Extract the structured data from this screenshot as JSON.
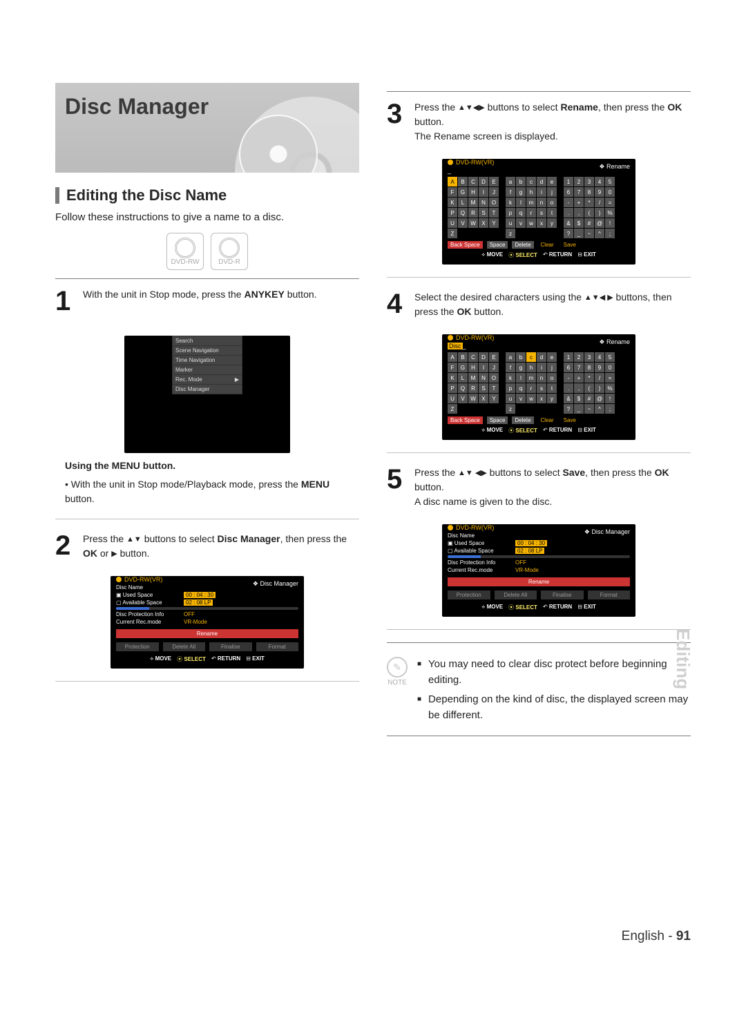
{
  "banner": {
    "title": "Disc Manager"
  },
  "section": {
    "title": "Editing the Disc Name",
    "lead": "Follow these instructions to give a name to a disc."
  },
  "badges": {
    "a": "DVD-RW",
    "b": "DVD-R"
  },
  "step1": {
    "text_pre": "With the unit in Stop mode, press the ",
    "text_bold": "ANYKEY",
    "text_post": " button."
  },
  "step1_sub": {
    "heading": "Using the MENU button.",
    "bullet_pre": "With the unit in Stop mode/Playback mode, press the ",
    "bullet_bold": "MENU",
    "bullet_post": " button."
  },
  "step2": {
    "pre": "Press the ",
    "mid": " buttons to select ",
    "bold1": "Disc Manager",
    "mid2": ", then press the ",
    "bold2": "OK",
    "mid3": " or ",
    "post": " button."
  },
  "step3": {
    "pre": "Press the ",
    "mid": " buttons to select ",
    "bold1": "Rename",
    "mid2": ", then press the ",
    "bold2": "OK",
    "post": " button.",
    "line2": "The Rename screen is displayed."
  },
  "step4": {
    "pre": "Select the desired characters using the ",
    "mid": " buttons, then press the ",
    "bold": "OK",
    "post": " button."
  },
  "step5": {
    "pre": "Press the ",
    "mid": " buttons to select ",
    "bold1": "Save",
    "mid2": ", then press the ",
    "bold2": "OK",
    "post": " button.",
    "line2": "A disc name is given to the disc."
  },
  "osd1": {
    "menu": [
      "Search",
      "Scene Navigation",
      "Time Navigation",
      "Marker",
      "Rec. Mode",
      "Disc Manager"
    ]
  },
  "osd_dm": {
    "title": "Disc Manager",
    "src": "DVD-RW(VR)",
    "rows": [
      {
        "lbl": "Disc Name",
        "val": ""
      },
      {
        "lbl": "Used Space",
        "val": "00 : 04 : 30"
      },
      {
        "lbl": "Available Space",
        "val": "02 : 08 LP"
      },
      {
        "lbl": "Disc Protection Info",
        "val": "OFF"
      },
      {
        "lbl": "Current Rec.mode",
        "val": "VR-Mode"
      }
    ],
    "btns": [
      "Rename",
      "Protection",
      "Delete All",
      "Finalise",
      "Format"
    ],
    "foot": {
      "move": "MOVE",
      "select": "SELECT",
      "return": "RETURN",
      "exit": "EXIT"
    }
  },
  "osd_rename": {
    "title": "Rename",
    "src": "DVD-RW(VR)",
    "input1": "",
    "input2": "Disc",
    "upper": [
      "A",
      "B",
      "C",
      "D",
      "E",
      "F",
      "G",
      "H",
      "I",
      "J",
      "K",
      "L",
      "M",
      "N",
      "O",
      "P",
      "Q",
      "R",
      "S",
      "T",
      "U",
      "V",
      "W",
      "X",
      "Y",
      "Z"
    ],
    "lower": [
      "a",
      "b",
      "c",
      "d",
      "e",
      "f",
      "g",
      "h",
      "i",
      "j",
      "k",
      "l",
      "m",
      "n",
      "o",
      "p",
      "q",
      "r",
      "s",
      "t",
      "u",
      "v",
      "w",
      "x",
      "y",
      "z"
    ],
    "num": [
      "1",
      "2",
      "3",
      "4",
      "5",
      "6",
      "7",
      "8",
      "9",
      "0",
      "-",
      "+",
      "*",
      "/",
      "=",
      ".",
      ",",
      "(",
      ")",
      "%",
      "&",
      "$",
      "#",
      "@",
      "!",
      "?",
      "_",
      "~",
      "^",
      ";"
    ],
    "funcs": [
      "Back Space",
      "Space",
      "Delete",
      "Clear",
      "Save"
    ],
    "foot": {
      "move": "MOVE",
      "select": "SELECT",
      "return": "RETURN",
      "exit": "EXIT"
    }
  },
  "notes": {
    "label": "NOTE",
    "items": [
      "You may need to clear disc protect before beginning editing.",
      "Depending on the kind of disc, the displayed screen may be different."
    ]
  },
  "side": "Editing",
  "footer": {
    "lang": "English",
    "sep": " - ",
    "page": "91"
  }
}
